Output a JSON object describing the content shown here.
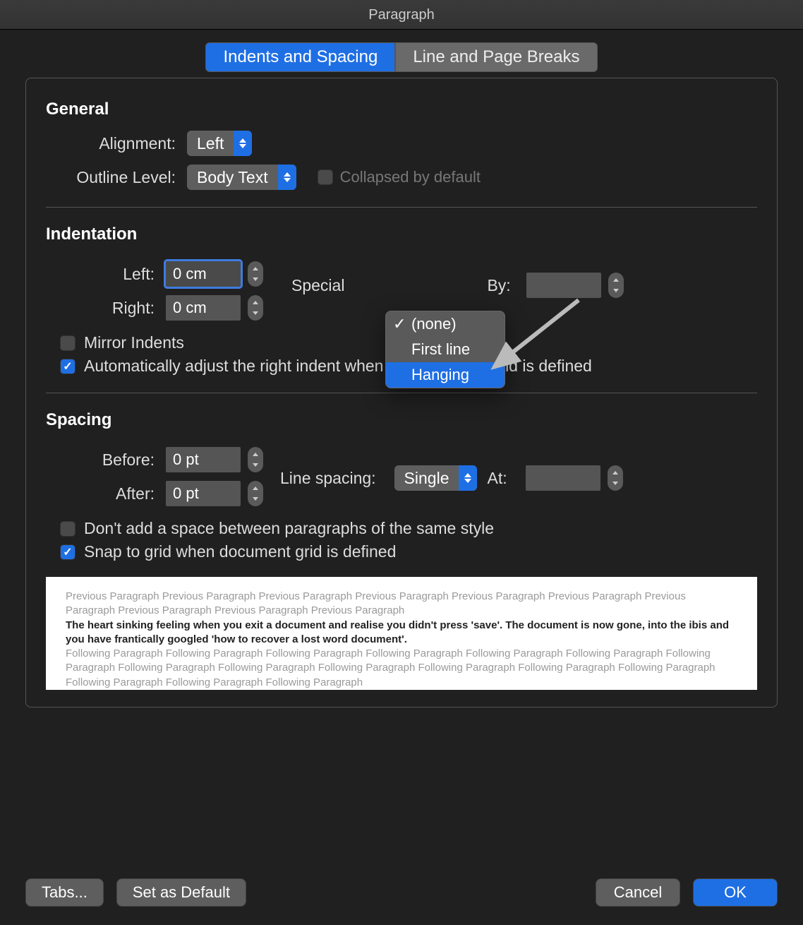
{
  "title": "Paragraph",
  "tabs": {
    "indents": "Indents and Spacing",
    "breaks": "Line and Page Breaks"
  },
  "sections": {
    "general": "General",
    "indent": "Indentation",
    "spacing": "Spacing"
  },
  "labels": {
    "alignment": "Alignment:",
    "outline": "Outline Level:",
    "collapsed": "Collapsed by default",
    "left": "Left:",
    "right": "Right:",
    "special": "Special",
    "by": "By:",
    "mirror": "Mirror Indents",
    "auto_indent": "Automatically adjust the right indent when the document grid is defined",
    "before": "Before:",
    "after": "After:",
    "line_sp": "Line spacing:",
    "at": "At:",
    "dont_space": "Don't add a space between paragraphs of the same style",
    "snap": "Snap to grid when document grid is defined"
  },
  "values": {
    "alignment": "Left",
    "outline": "Body Text",
    "left": "0 cm",
    "right": "0 cm",
    "before": "0 pt",
    "after": "0 pt",
    "line_sp": "Single",
    "by": "",
    "at": ""
  },
  "special_menu": {
    "none": "(none)",
    "first": "First line",
    "hanging": "Hanging"
  },
  "footer": {
    "tabs": "Tabs...",
    "default": "Set as Default",
    "cancel": "Cancel",
    "ok": "OK"
  },
  "preview": {
    "prev": "Previous Paragraph Previous Paragraph Previous Paragraph Previous Paragraph Previous Paragraph Previous Paragraph Previous Paragraph Previous Paragraph Previous Paragraph Previous Paragraph",
    "cur": "The heart sinking feeling when you exit a document and realise you didn't press 'save'. The document is now gone, into the ibis and you have frantically googled 'how to recover a lost word document'.",
    "next": "Following Paragraph Following Paragraph Following Paragraph Following Paragraph Following Paragraph Following Paragraph Following Paragraph Following Paragraph Following Paragraph Following Paragraph Following Paragraph Following Paragraph Following Paragraph Following Paragraph Following Paragraph Following Paragraph"
  }
}
